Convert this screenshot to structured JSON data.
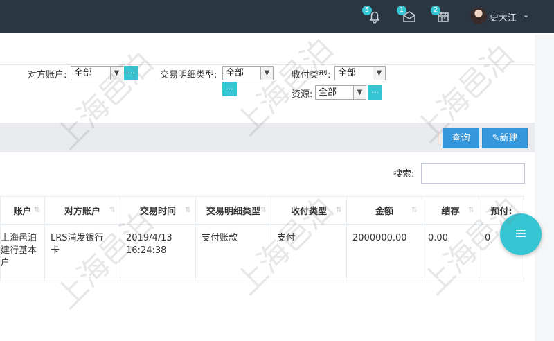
{
  "header": {
    "notifications": [
      {
        "icon": "bell-icon",
        "badge": "5"
      },
      {
        "icon": "envelope-icon",
        "badge": "1"
      },
      {
        "icon": "calendar-icon",
        "badge": "2"
      }
    ],
    "user_name": "史大江",
    "user_caret": "⌄"
  },
  "filters": {
    "counterparty_account": {
      "label": "对方账户:",
      "value": "全部"
    },
    "detail_type": {
      "label": "交易明细类型:",
      "value": "全部"
    },
    "pay_type": {
      "label": "收付类型:",
      "value": "全部"
    },
    "source": {
      "label": "资源:",
      "value": "全部"
    },
    "more_label": "..."
  },
  "toolbar": {
    "query_label": "查询",
    "new_label": "新建"
  },
  "search": {
    "label": "搜索:",
    "placeholder": ""
  },
  "table": {
    "columns": [
      "账户",
      "对方账户",
      "交易时间",
      "交易明细类型",
      "收付类型",
      "金额",
      "结存",
      "预付:"
    ],
    "rows": [
      {
        "account": "上海邑泊\n建行基本\n户",
        "counterparty": "LRS浦发银行\n卡",
        "time": "2019/4/13\n16:24:38",
        "detail_type": "支付账款",
        "pay_type": "支付",
        "amount": "2000000.00",
        "balance": "0.00",
        "prepay": "0"
      }
    ]
  },
  "watermark_text": "上海邑泊"
}
